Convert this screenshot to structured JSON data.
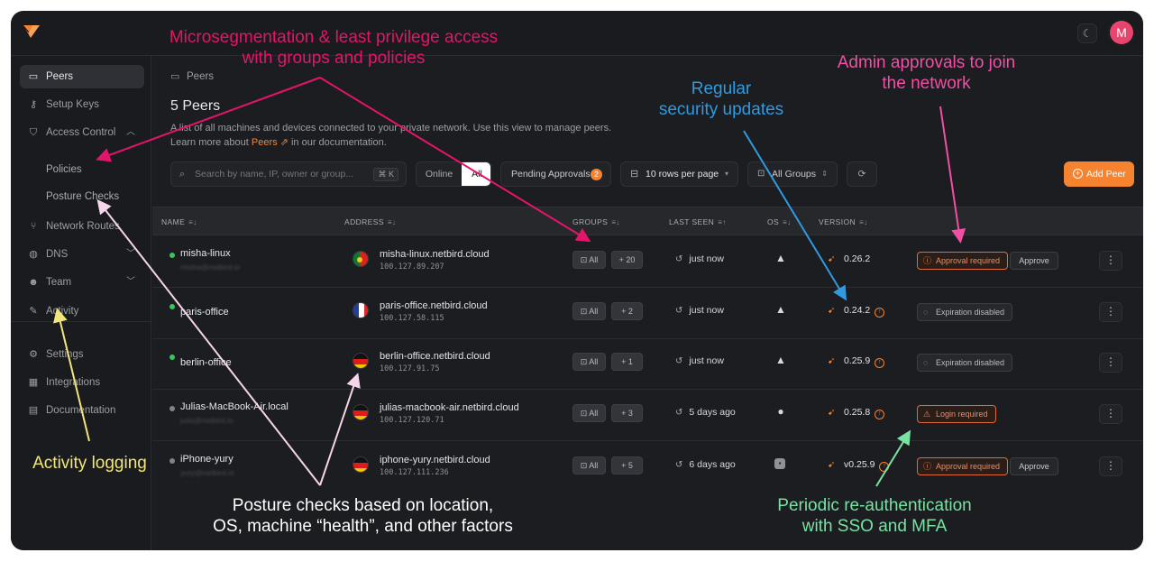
{
  "colors": {
    "accent": "#f68330",
    "online": "#34c759",
    "offline": "#80838a",
    "approval": "#e26a3a"
  },
  "topbar": {
    "logo_icon": "netbird-logo-icon",
    "theme_icon": "moon-icon",
    "avatar_initial": "M"
  },
  "sidebar": {
    "items": [
      {
        "label": "Peers",
        "icon": "monitor-icon"
      },
      {
        "label": "Setup Keys",
        "icon": "key-icon"
      },
      {
        "label": "Access Control",
        "icon": "shield-icon"
      },
      {
        "label": "Policies"
      },
      {
        "label": "Posture Checks"
      },
      {
        "label": "Network Routes",
        "icon": "route-icon"
      },
      {
        "label": "DNS",
        "icon": "globe-icon"
      },
      {
        "label": "Team",
        "icon": "users-icon"
      },
      {
        "label": "Activity",
        "icon": "activity-icon"
      },
      {
        "label": "Settings",
        "icon": "gear-icon"
      },
      {
        "label": "Integrations",
        "icon": "grid-icon"
      },
      {
        "label": "Documentation",
        "icon": "book-icon"
      }
    ]
  },
  "main": {
    "breadcrumb": "Peers",
    "title": "5 Peers",
    "description_line1": "A list of all machines and devices connected to your private network. Use this view to manage peers.",
    "description_pre": "Learn more about ",
    "description_link": "Peers",
    "description_post": " in our documentation."
  },
  "toolbar": {
    "search_placeholder": "Search by name, IP, owner or group...",
    "search_shortcut": "⌘ K",
    "filter_online": "Online",
    "filter_all": "All",
    "pending_label": "Pending Approvals",
    "pending_count": "2",
    "rows_label": "10 rows per page",
    "groups_label": "All Groups",
    "add_peer_label": "Add Peer"
  },
  "table": {
    "headers": {
      "name": "NAME",
      "address": "ADDRESS",
      "groups": "GROUPS",
      "last_seen": "LAST SEEN",
      "os": "OS",
      "version": "VERSION"
    },
    "rows": [
      {
        "name": "misha-linux",
        "owner": "misha@netbird.io",
        "status": "online",
        "flag": "pt",
        "dns": "misha-linux.netbird.cloud",
        "ip": "100.127.89.207",
        "group_all": "All",
        "group_more": "+ 20",
        "last_seen": "just now",
        "os_icon": "linux-icon",
        "version": "0.26.2",
        "update_available": false,
        "tag": "Approval required",
        "tag_type": "warn",
        "tag_icon": "alert-circle-icon",
        "action": "Approve"
      },
      {
        "name": "paris-office",
        "owner": "",
        "status": "online",
        "flag": "fr",
        "dns": "paris-office.netbird.cloud",
        "ip": "100.127.58.115",
        "group_all": "All",
        "group_more": "+ 2",
        "last_seen": "just now",
        "os_icon": "linux-icon",
        "version": "0.24.2",
        "update_available": true,
        "tag": "Expiration disabled",
        "tag_type": "neutral",
        "tag_icon": "eye-off-icon",
        "action": ""
      },
      {
        "name": "berlin-office",
        "owner": "",
        "status": "online",
        "flag": "de",
        "dns": "berlin-office.netbird.cloud",
        "ip": "100.127.91.75",
        "group_all": "All",
        "group_more": "+ 1",
        "last_seen": "just now",
        "os_icon": "linux-icon",
        "version": "0.25.9",
        "update_available": true,
        "tag": "Expiration disabled",
        "tag_type": "neutral",
        "tag_icon": "eye-off-icon",
        "action": ""
      },
      {
        "name": "Julias-MacBook-Air.local",
        "owner": "julia@netbird.io",
        "status": "offline",
        "flag": "de",
        "dns": "julias-macbook-air.netbird.cloud",
        "ip": "100.127.120.71",
        "group_all": "All",
        "group_more": "+ 3",
        "last_seen": "5 days ago",
        "os_icon": "apple-icon",
        "version": "0.25.8",
        "update_available": true,
        "tag": "Login required",
        "tag_type": "warn",
        "tag_icon": "warning-triangle-icon",
        "action": ""
      },
      {
        "name": "iPhone-yury",
        "owner": "yury@netbird.io",
        "status": "offline",
        "flag": "de",
        "dns": "iphone-yury.netbird.cloud",
        "ip": "100.127.111.236",
        "group_all": "All",
        "group_more": "+ 5",
        "last_seen": "6 days ago",
        "os_icon": "ios-icon",
        "version": "v0.25.9",
        "update_available": true,
        "tag": "Approval required",
        "tag_type": "warn",
        "tag_icon": "alert-circle-icon",
        "action": "Approve"
      }
    ]
  },
  "annotations": {
    "microsegmentation_line1": "Microsegmentation & least privilege access",
    "microsegmentation_line2": "with groups and policies",
    "updates_line1": "Regular",
    "updates_line2": "security updates",
    "approvals_line1": "Admin approvals to join",
    "approvals_line2": "the network",
    "activity": "Activity logging",
    "posture_line1": "Posture checks based on location,",
    "posture_line2": "OS, machine “health”, and other factors",
    "reauth_line1": "Periodic re-authentication",
    "reauth_line2": "with SSO and MFA"
  }
}
